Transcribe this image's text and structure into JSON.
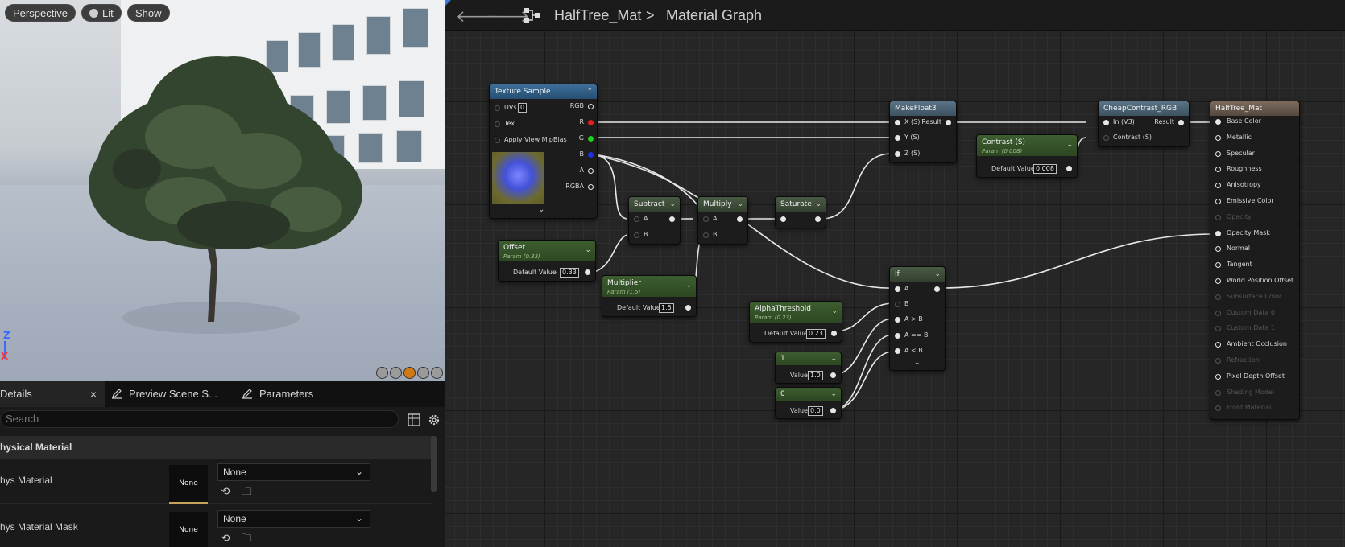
{
  "viewport": {
    "perspective_label": "Perspective",
    "lit_label": "Lit",
    "show_label": "Show",
    "axis_z": "Z",
    "axis_x": "X"
  },
  "details": {
    "tabs": [
      {
        "label": "Details",
        "close": "×"
      },
      {
        "label": "Preview Scene S..."
      },
      {
        "label": "Parameters"
      }
    ],
    "search_placeholder": "Search",
    "category": "hysical Material",
    "rows": [
      {
        "label": "hys Material",
        "thumb": "None",
        "value": "None"
      },
      {
        "label": "hys Material Mask",
        "thumb": "None",
        "value": "None"
      }
    ]
  },
  "graph": {
    "breadcrumb": {
      "asset": "HalfTree_Mat",
      "separator": ">",
      "graph": "Material Graph"
    },
    "nodes": {
      "texture_sample": {
        "title": "Texture Sample",
        "inputs": [
          "UVs",
          "Tex",
          "Apply View MipBias"
        ],
        "uvs_value": "0",
        "outputs": [
          "RGB",
          "R",
          "G",
          "B",
          "A",
          "RGBA"
        ]
      },
      "subtract": {
        "title": "Subtract",
        "inputs": [
          "A",
          "B"
        ]
      },
      "multiply": {
        "title": "Multiply",
        "inputs": [
          "A",
          "B"
        ]
      },
      "saturate": {
        "title": "Saturate"
      },
      "offset": {
        "title": "Offset",
        "subtitle": "Param (0.33)",
        "label": "Default Value",
        "value": "0.33"
      },
      "multiplier": {
        "title": "Multiplier",
        "subtitle": "Param (1.5)",
        "label": "Default Value",
        "value": "1.5"
      },
      "alpha_threshold": {
        "title": "AlphaThreshold",
        "subtitle": "Param (0.23)",
        "label": "Default Value",
        "value": "0.23"
      },
      "const_one": {
        "title": "1",
        "label": "Value",
        "value": "1.0"
      },
      "const_zero": {
        "title": "0",
        "label": "Value",
        "value": "0.0"
      },
      "makefloat3": {
        "title": "MakeFloat3",
        "inputs": [
          "X (S)",
          "Y (S)",
          "Z (S)"
        ],
        "output": "Result"
      },
      "contrast": {
        "title": "Contrast (S)",
        "subtitle": "Param (0.008)",
        "label": "Default Value",
        "value": "0.008"
      },
      "cheapcontrast": {
        "title": "CheapContrast_RGB",
        "inputs": [
          "In (V3)",
          "Contrast (S)"
        ],
        "output": "Result"
      },
      "if_node": {
        "title": "If",
        "inputs": [
          "A",
          "B",
          "A > B",
          "A == B",
          "A < B"
        ]
      },
      "result": {
        "title": "HalfTree_Mat",
        "pins": [
          {
            "label": "Base Color",
            "active": true
          },
          {
            "label": "Metallic",
            "active": true
          },
          {
            "label": "Specular",
            "active": true
          },
          {
            "label": "Roughness",
            "active": true
          },
          {
            "label": "Anisotropy",
            "active": true
          },
          {
            "label": "Emissive Color",
            "active": true
          },
          {
            "label": "Opacity",
            "active": false
          },
          {
            "label": "Opacity Mask",
            "active": true
          },
          {
            "label": "Normal",
            "active": true
          },
          {
            "label": "Tangent",
            "active": true
          },
          {
            "label": "World Position Offset",
            "active": true
          },
          {
            "label": "Subsurface Color",
            "active": false
          },
          {
            "label": "Custom Data 0",
            "active": false
          },
          {
            "label": "Custom Data 1",
            "active": false
          },
          {
            "label": "Ambient Occlusion",
            "active": true
          },
          {
            "label": "Refraction",
            "active": false
          },
          {
            "label": "Pixel Depth Offset",
            "active": true
          },
          {
            "label": "Shading Model",
            "active": false
          },
          {
            "label": "Front Material",
            "active": false
          }
        ]
      }
    }
  },
  "colors": {
    "red_pin": "#e02020",
    "green_pin": "#20d020",
    "blue_pin": "#2030e0",
    "accent": "#c8a35a"
  }
}
